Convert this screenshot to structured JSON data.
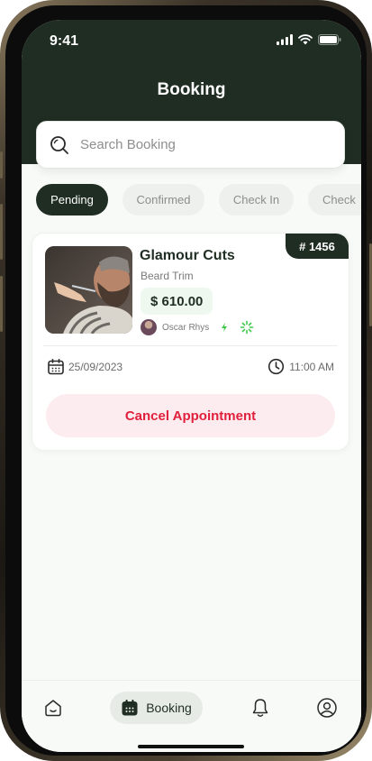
{
  "status_bar": {
    "time": "9:41"
  },
  "header": {
    "title": "Booking"
  },
  "search": {
    "placeholder": "Search Booking"
  },
  "tabs": [
    {
      "label": "Pending",
      "active": true
    },
    {
      "label": "Confirmed",
      "active": false
    },
    {
      "label": "Check In",
      "active": false
    },
    {
      "label": "Check",
      "active": false
    }
  ],
  "booking": {
    "id": "# 1456",
    "shop_name": "Glamour Cuts",
    "service": "Beard Trim",
    "price": "$ 610.00",
    "barber": "Oscar Rhys",
    "date": "25/09/2023",
    "time": "11:00 AM",
    "cancel_label": "Cancel Appointment"
  },
  "bottom_nav": {
    "items": [
      {
        "icon": "home-icon"
      },
      {
        "icon": "calendar-icon",
        "label": "Booking",
        "active": true
      },
      {
        "icon": "bell-icon"
      },
      {
        "icon": "profile-icon"
      }
    ]
  },
  "colors": {
    "primary": "#1f2d22",
    "danger": "#e0203c",
    "danger_bg": "#fdecef",
    "price_bg": "#eef8ef",
    "accent_green": "#3ec94b"
  }
}
